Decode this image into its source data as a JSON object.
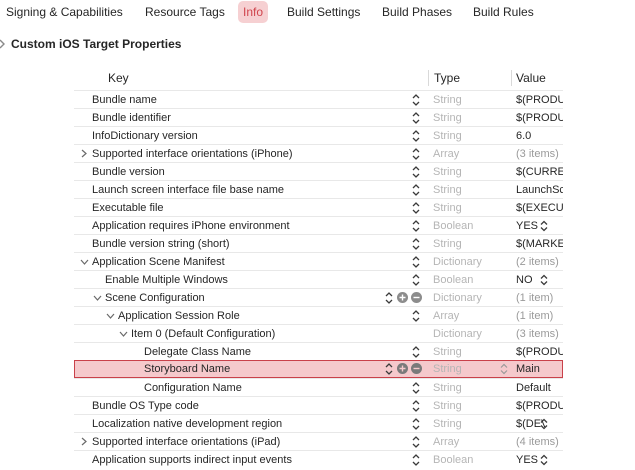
{
  "tabs": [
    {
      "label": "Signing & Capabilities",
      "active": false
    },
    {
      "label": "Resource Tags",
      "active": false
    },
    {
      "label": "Info",
      "active": true
    },
    {
      "label": "Build Settings",
      "active": false
    },
    {
      "label": "Build Phases",
      "active": false
    },
    {
      "label": "Build Rules",
      "active": false
    }
  ],
  "section": {
    "title": "Custom iOS Target Properties"
  },
  "columns": {
    "key": "Key",
    "type": "Type",
    "value": "Value"
  },
  "accent_color": "#d0454d",
  "rows": [
    {
      "key": "Bundle name",
      "type": "String",
      "value": "$(PRODUCT_NAME)"
    },
    {
      "key": "Bundle identifier",
      "type": "String",
      "value": "$(PRODUCT_BUNDLE_IDENTIFIER)"
    },
    {
      "key": "InfoDictionary version",
      "type": "String",
      "value": "6.0"
    },
    {
      "key": "Supported interface orientations (iPhone)",
      "type": "Array",
      "value": "(3 items)"
    },
    {
      "key": "Bundle version",
      "type": "String",
      "value": "$(CURRENT_PROJECT_VERSION)"
    },
    {
      "key": "Launch screen interface file base name",
      "type": "String",
      "value": "LaunchScreen"
    },
    {
      "key": "Executable file",
      "type": "String",
      "value": "$(EXECUTABLE_NAME)"
    },
    {
      "key": "Application requires iPhone environment",
      "type": "Boolean",
      "value": "YES"
    },
    {
      "key": "Bundle version string (short)",
      "type": "String",
      "value": "$(MARKETING_VERSION)"
    },
    {
      "key": "Application Scene Manifest",
      "type": "Dictionary",
      "value": "(2 items)"
    },
    {
      "key": "Enable Multiple Windows",
      "type": "Boolean",
      "value": "NO"
    },
    {
      "key": "Scene Configuration",
      "type": "Dictionary",
      "value": "(1 item)"
    },
    {
      "key": "Application Session Role",
      "type": "Array",
      "value": "(1 item)"
    },
    {
      "key": "Item 0 (Default Configuration)",
      "type": "Dictionary",
      "value": "(3 items)"
    },
    {
      "key": "Delegate Class Name",
      "type": "String",
      "value": "$(PRODUCT_MODULE_NAME).SceneDelegate"
    },
    {
      "key": "Storyboard Name",
      "type": "String",
      "value": "Main"
    },
    {
      "key": "Configuration Name",
      "type": "String",
      "value": "Default"
    },
    {
      "key": "Bundle OS Type code",
      "type": "String",
      "value": "$(PRODUCT_BUNDLE_PACKAGE_TYPE)"
    },
    {
      "key": "Localization native development region",
      "type": "String",
      "value": "$(DEVELOPMENT_LANGUAGE)"
    },
    {
      "key": "Supported interface orientations (iPad)",
      "type": "Array",
      "value": "(4 items)"
    },
    {
      "key": "Application supports indirect input events",
      "type": "Boolean",
      "value": "YES"
    }
  ]
}
